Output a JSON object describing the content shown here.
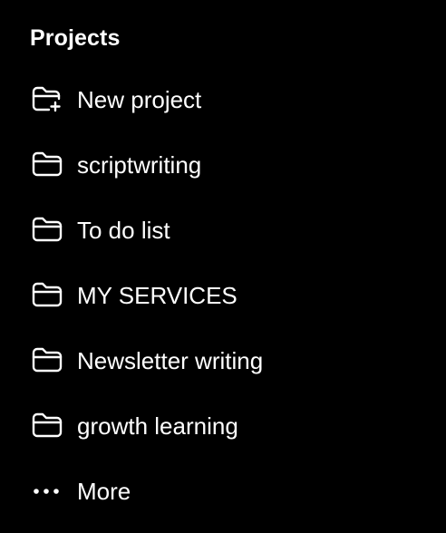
{
  "sidebar": {
    "section_title": "Projects",
    "items": [
      {
        "label": "New project",
        "icon": "folder-plus-icon"
      },
      {
        "label": "scriptwriting",
        "icon": "folder-icon"
      },
      {
        "label": "To do list",
        "icon": "folder-icon"
      },
      {
        "label": "MY SERVICES",
        "icon": "folder-icon"
      },
      {
        "label": "Newsletter writing",
        "icon": "folder-icon"
      },
      {
        "label": "growth learning",
        "icon": "folder-icon"
      },
      {
        "label": "More",
        "icon": "more-dots-icon"
      }
    ]
  },
  "colors": {
    "background": "#000000",
    "text": "#ffffff"
  }
}
